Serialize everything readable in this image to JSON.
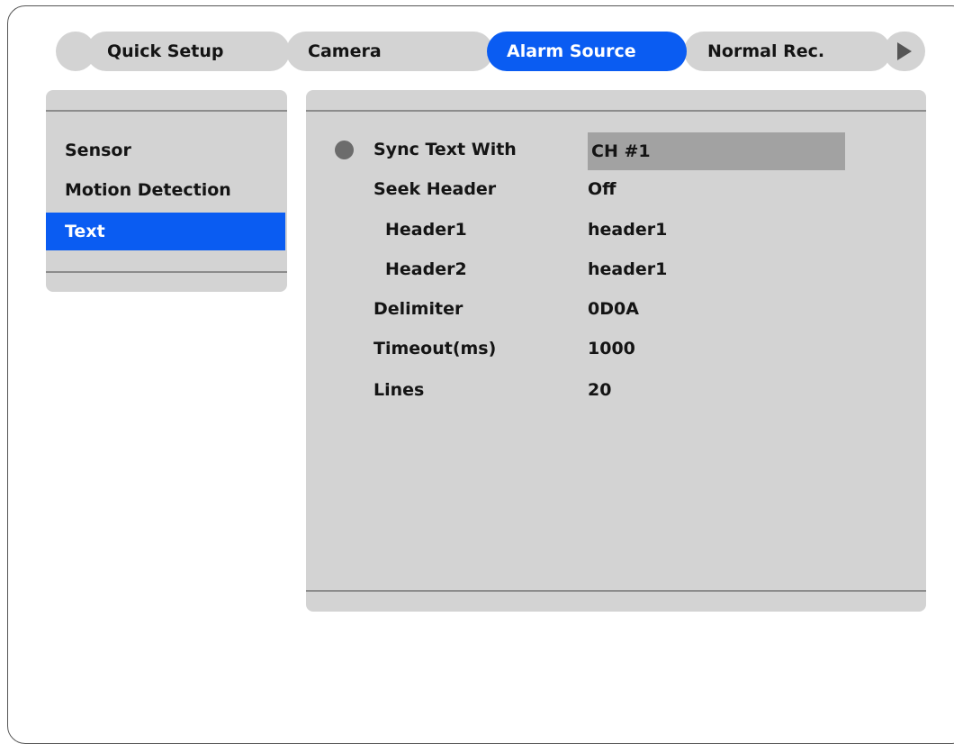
{
  "tabs": [
    {
      "label": "Quick Setup",
      "active": false
    },
    {
      "label": "Camera",
      "active": false
    },
    {
      "label": "Alarm Source",
      "active": true
    },
    {
      "label": "Normal Rec.",
      "active": false
    }
  ],
  "tab_next_icon": "play-right-triangle",
  "sidebar": {
    "items": [
      {
        "label": "Sensor",
        "selected": false
      },
      {
        "label": "Motion Detection",
        "selected": false
      },
      {
        "label": "Text",
        "selected": true
      }
    ]
  },
  "settings": [
    {
      "label": "Sync Text With",
      "value": "CH #1",
      "focused": true
    },
    {
      "label": "Seek Header",
      "value": "Off"
    },
    {
      "label": "Header1",
      "value": "header1"
    },
    {
      "label": "Header2",
      "value": "header1"
    },
    {
      "label": "Delimiter",
      "value": "0D0A"
    },
    {
      "label": "Timeout(ms)",
      "value": "1000"
    },
    {
      "label": "Lines",
      "value": "20"
    }
  ],
  "colors": {
    "accent": "#0a5cf2",
    "panel": "#d3d3d3",
    "focus_field": "#a2a2a2",
    "rule": "#8c8c8c"
  }
}
